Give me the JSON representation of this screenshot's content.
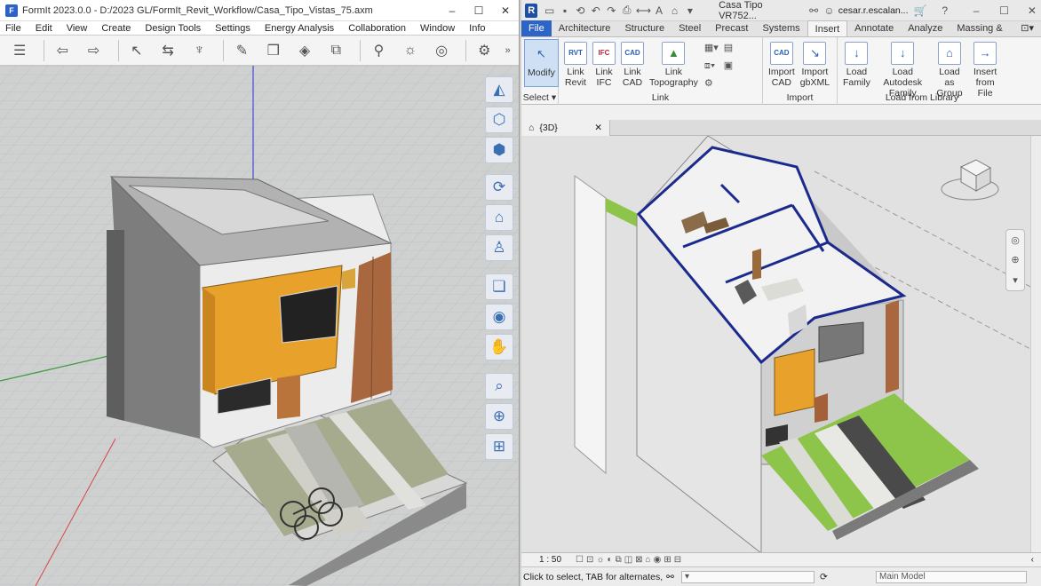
{
  "formit": {
    "title": "FormIt 2023.0.0 - D:/2023 GL/FormIt_Revit_Workflow/Casa_Tipo_Vistas_75.axm",
    "menu": [
      "File",
      "Edit",
      "View",
      "Create",
      "Design Tools",
      "Settings",
      "Energy Analysis",
      "Collaboration",
      "Window",
      "Info"
    ],
    "toolbar_more": "»"
  },
  "revit": {
    "title": "Casa Tipo VR752...",
    "user": "cesar.r.escalan...",
    "tabs": [
      "File",
      "Architecture",
      "Structure",
      "Steel",
      "Precast",
      "Systems",
      "Insert",
      "Annotate",
      "Analyze",
      "Massing & Site"
    ],
    "active_tab": "Insert",
    "select_panel": {
      "modify": "Modify",
      "label": "Select"
    },
    "link_panel": {
      "label": "Link",
      "buttons": [
        {
          "line1": "Link",
          "line2": "Revit",
          "glyph": "RVT"
        },
        {
          "line1": "Link",
          "line2": "IFC",
          "glyph": "IFC"
        },
        {
          "line1": "Link",
          "line2": "CAD",
          "glyph": "CAD"
        },
        {
          "line1": "Link",
          "line2": "Topography",
          "glyph": "▲"
        }
      ]
    },
    "import_panel": {
      "label": "Import",
      "buttons": [
        {
          "line1": "Import",
          "line2": "CAD",
          "glyph": "CAD"
        },
        {
          "line1": "Import",
          "line2": "gbXML",
          "glyph": "↘"
        }
      ]
    },
    "library_panel": {
      "label": "Load from Library",
      "buttons": [
        {
          "line1": "Load",
          "line2": "Family",
          "glyph": "↓"
        },
        {
          "line1": "Load Autodesk",
          "line2": "Family",
          "glyph": "↓"
        },
        {
          "line1": "Load as",
          "line2": "Group",
          "glyph": "⌂"
        },
        {
          "line1": "Insert",
          "line2": "from File",
          "glyph": "→"
        }
      ]
    },
    "view_tab": "{3D}",
    "scale": "1 : 50",
    "status": "Click to select, TAB for alternates,",
    "main_model": "Main Model"
  }
}
